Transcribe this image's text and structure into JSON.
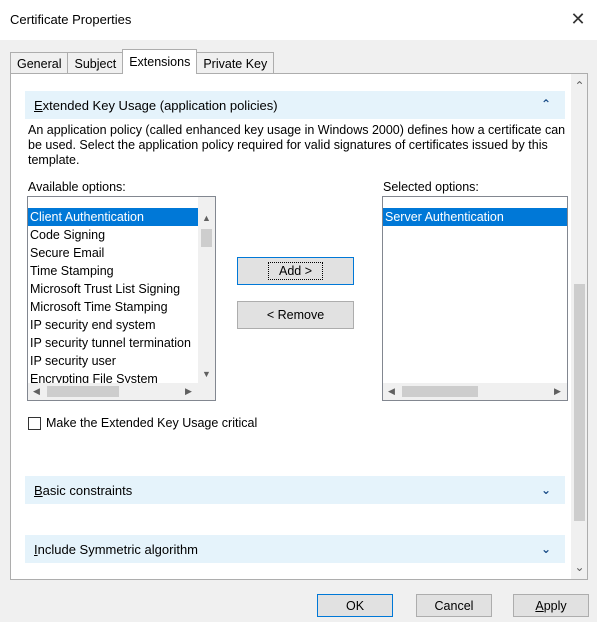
{
  "window": {
    "title": "Certificate Properties",
    "close_glyph": "✕"
  },
  "tabs": [
    {
      "label": "General"
    },
    {
      "label": "Subject"
    },
    {
      "label": "Extensions"
    },
    {
      "label": "Private Key"
    }
  ],
  "eku": {
    "header_first": "E",
    "header_rest": "xtended Key Usage (application policies)",
    "description": "An application policy (called enhanced key usage in Windows 2000) defines how a certificate can be used. Select the application policy required for valid signatures of certificates issued by this template.",
    "available_label": "Available options:",
    "available_items": [
      "Client Authentication",
      "Code Signing",
      "Secure Email",
      "Time Stamping",
      "Microsoft Trust List Signing",
      "Microsoft Time Stamping",
      "IP security end system",
      "IP security tunnel termination",
      "IP security user",
      "Encrypting File System"
    ],
    "selected_label": "Selected options:",
    "selected_items": [
      "Server Authentication"
    ],
    "add_label": "Add >",
    "remove_label": "< Remove",
    "critical_label": "Make the Extended Key Usage critical",
    "critical_checked": false
  },
  "basic_constraints": {
    "first": "B",
    "rest": "asic constraints"
  },
  "symmetric": {
    "first": "I",
    "rest": "nclude Symmetric algorithm"
  },
  "footer": {
    "ok": "OK",
    "cancel": "Cancel",
    "apply_first": "A",
    "apply_rest": "pply"
  },
  "icons": {
    "collapse": "chevron-up-icon",
    "expand": "chevron-down-icon"
  },
  "colors": {
    "selection": "#0078d7",
    "section_header": "#e5f3fb",
    "chevron": "#1c4e89"
  }
}
